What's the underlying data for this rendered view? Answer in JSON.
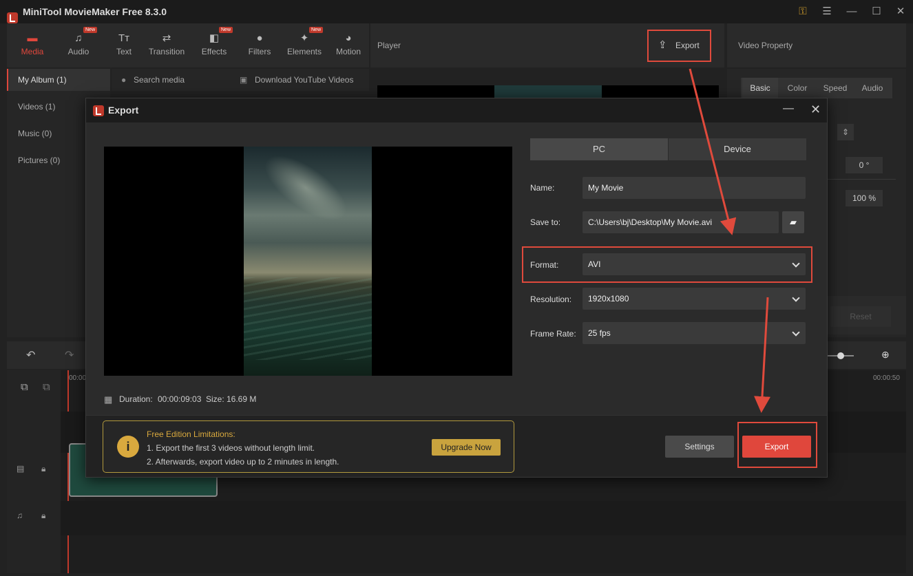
{
  "app": {
    "title": "MiniTool MovieMaker Free 8.3.0"
  },
  "toolbar": {
    "items": [
      {
        "label": "Media",
        "icon": "media-icon",
        "new": ""
      },
      {
        "label": "Audio",
        "icon": "audio-icon",
        "new": "New"
      },
      {
        "label": "Text",
        "icon": "text-icon",
        "new": ""
      },
      {
        "label": "Transition",
        "icon": "transition-icon",
        "new": ""
      },
      {
        "label": "Effects",
        "icon": "effects-icon",
        "new": "New"
      },
      {
        "label": "Filters",
        "icon": "filters-icon",
        "new": ""
      },
      {
        "label": "Elements",
        "icon": "elements-icon",
        "new": "New"
      },
      {
        "label": "Motion",
        "icon": "motion-icon",
        "new": ""
      }
    ]
  },
  "sidebar": {
    "items": [
      {
        "label": "My Album (1)"
      },
      {
        "label": "Videos (1)"
      },
      {
        "label": "Music (0)"
      },
      {
        "label": "Pictures (0)"
      }
    ]
  },
  "media": {
    "search_placeholder": "Search media",
    "download_label": "Download YouTube Videos"
  },
  "player": {
    "title": "Player",
    "export_label": "Export"
  },
  "property": {
    "title": "Video Property",
    "tabs": [
      "Basic",
      "Color",
      "Speed",
      "Audio"
    ],
    "rotation": "0 °",
    "scale": "100 %",
    "reset_label": "Reset"
  },
  "timeline": {
    "time_start": "00:00",
    "time_end": "00:00:50"
  },
  "dialog": {
    "title": "Export",
    "tabs": {
      "pc": "PC",
      "device": "Device"
    },
    "name_label": "Name:",
    "name_value": "My Movie",
    "saveto_label": "Save to:",
    "saveto_value": "C:\\Users\\bj\\Desktop\\My Movie.avi",
    "format_label": "Format:",
    "format_value": "AVI",
    "resolution_label": "Resolution:",
    "resolution_value": "1920x1080",
    "framerate_label": "Frame Rate:",
    "framerate_value": "25 fps",
    "duration_label": "Duration:",
    "duration_value": "00:00:09:03",
    "size_label": "Size:",
    "size_value": "16.69 M",
    "notice": {
      "title": "Free Edition Limitations:",
      "line1": "1. Export the first 3 videos without length limit.",
      "line2": "2. Afterwards, export video up to 2 minutes in length.",
      "upgrade_label": "Upgrade Now"
    },
    "settings_label": "Settings",
    "export_label": "Export"
  },
  "colors": {
    "accent": "#e0473c",
    "highlight_box": "#e04a3c",
    "notice_border": "#b39a3e",
    "upgrade": "#c9a33e"
  }
}
